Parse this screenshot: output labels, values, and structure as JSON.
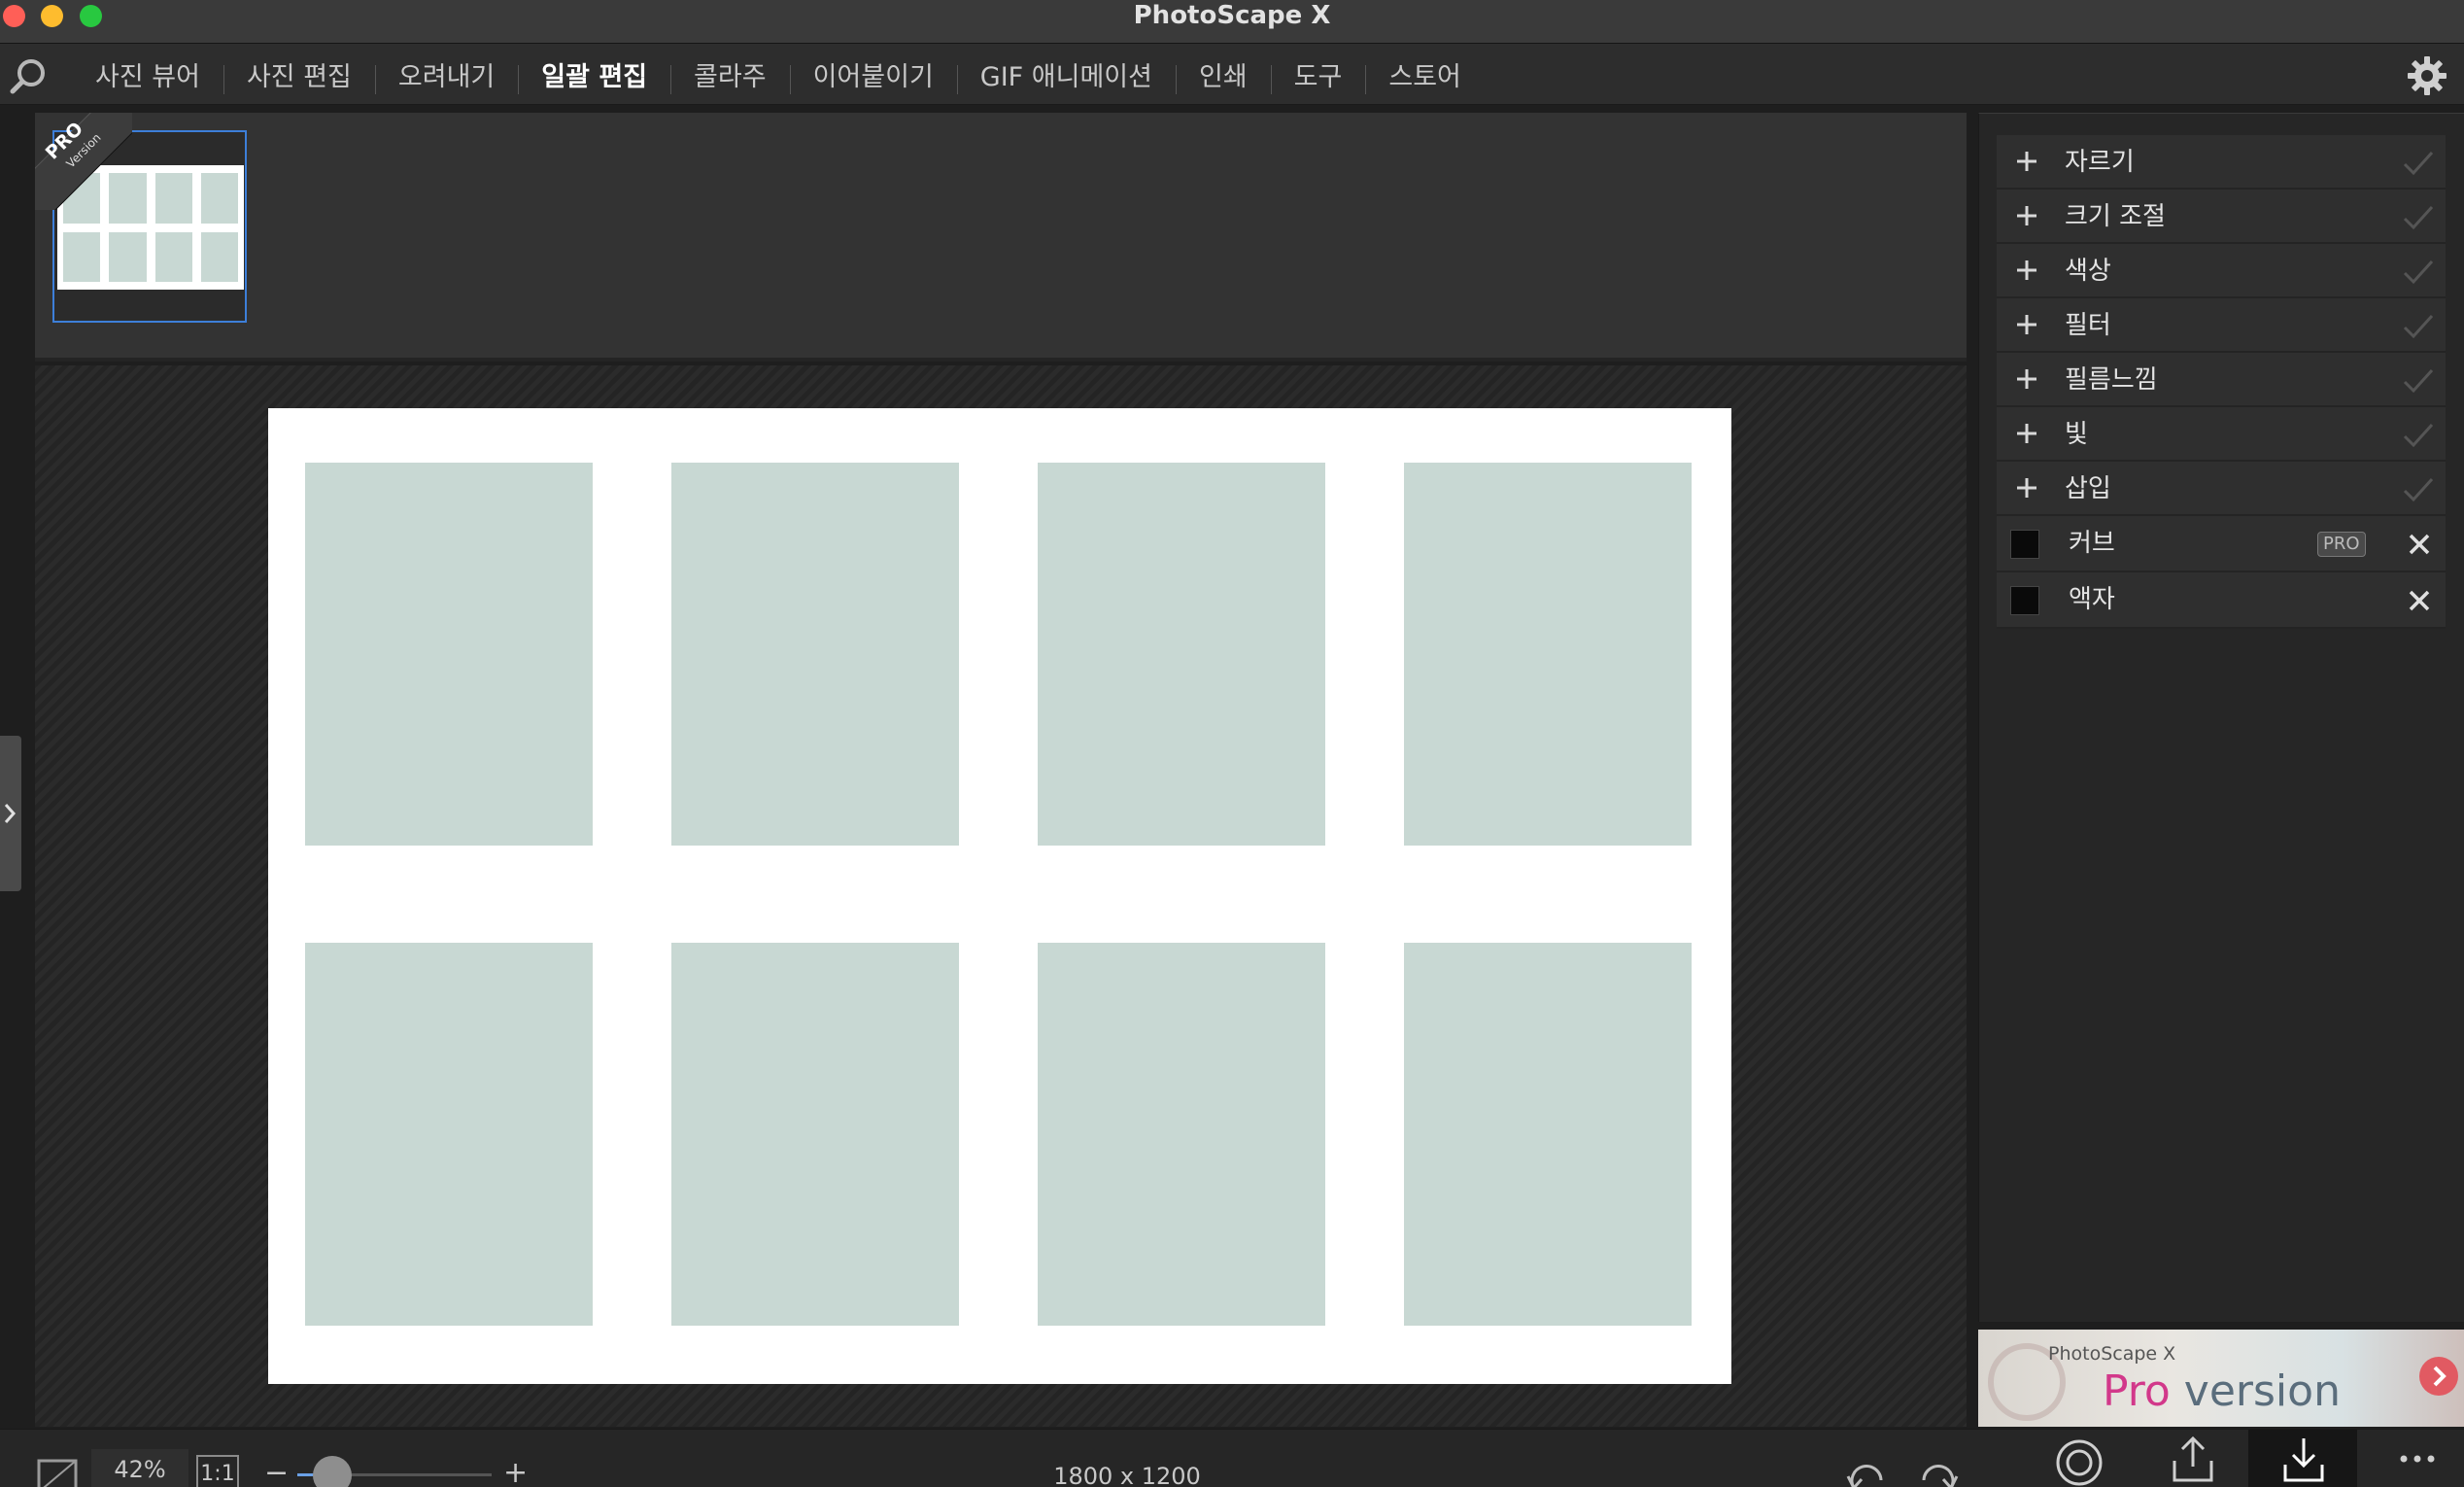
{
  "window": {
    "title": "PhotoScape X"
  },
  "menu": {
    "tabs": [
      {
        "label": "사진 뷰어"
      },
      {
        "label": "사진 편집"
      },
      {
        "label": "오려내기"
      },
      {
        "label": "일괄 편집",
        "active": true
      },
      {
        "label": "콜라주"
      },
      {
        "label": "이어붙이기"
      },
      {
        "label": "GIF 애니메이션"
      },
      {
        "label": "인쇄"
      },
      {
        "label": "도구"
      },
      {
        "label": "스토어"
      }
    ],
    "settings_icon": "gear-icon"
  },
  "filmstrip": {
    "ribbon_title": "PRO",
    "ribbon_subtitle": "Version"
  },
  "panel": {
    "tools": [
      {
        "label": "자르기"
      },
      {
        "label": "크기 조절"
      },
      {
        "label": "색상"
      },
      {
        "label": "필터"
      },
      {
        "label": "필름느낌"
      },
      {
        "label": "빛"
      },
      {
        "label": "삽입"
      }
    ],
    "options": [
      {
        "label": "커브",
        "badge": "PRO"
      },
      {
        "label": "액자"
      }
    ]
  },
  "banner": {
    "small": "PhotoScape X",
    "pro": "Pro",
    "version": " version"
  },
  "bottom": {
    "zoom": "42%",
    "one_to_one": "1:1",
    "minus": "−",
    "plus": "+",
    "zoom_fraction": 0.12,
    "dimensions": "1800 x 1200"
  },
  "colors": {
    "accent": "#3d7fd9",
    "cell": "#c8d8d3",
    "panel_bg": "#262626"
  }
}
